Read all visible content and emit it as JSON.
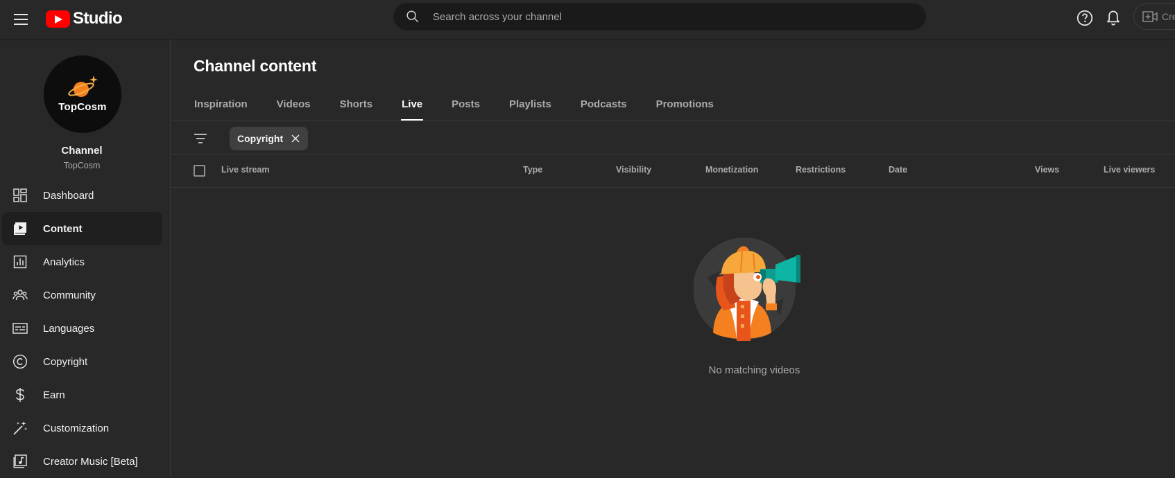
{
  "app": {
    "brand_text": "Studio",
    "search_placeholder": "Search across your channel",
    "create_label": "Cre"
  },
  "sidebar": {
    "avatar_text": "TopCosm",
    "channel_title": "Channel",
    "channel_name": "TopCosm",
    "items": [
      {
        "label": "Dashboard",
        "icon": "dashboard-icon"
      },
      {
        "label": "Content",
        "icon": "content-icon",
        "active": true
      },
      {
        "label": "Analytics",
        "icon": "analytics-icon"
      },
      {
        "label": "Community",
        "icon": "community-icon"
      },
      {
        "label": "Languages",
        "icon": "languages-icon"
      },
      {
        "label": "Copyright",
        "icon": "copyright-icon"
      },
      {
        "label": "Earn",
        "icon": "dollar-icon"
      },
      {
        "label": "Customization",
        "icon": "magic-wand-icon"
      },
      {
        "label": "Creator Music [Beta]",
        "icon": "music-note-icon"
      }
    ]
  },
  "main": {
    "title": "Channel content",
    "tabs": [
      {
        "label": "Inspiration"
      },
      {
        "label": "Videos"
      },
      {
        "label": "Shorts"
      },
      {
        "label": "Live",
        "active": true
      },
      {
        "label": "Posts"
      },
      {
        "label": "Playlists"
      },
      {
        "label": "Podcasts"
      },
      {
        "label": "Promotions"
      }
    ],
    "filter_chip": "Copyright",
    "columns": [
      "Live stream",
      "Type",
      "Visibility",
      "Monetization",
      "Restrictions",
      "Date",
      "Views",
      "Live viewers"
    ],
    "empty_message": "No matching videos"
  },
  "colors": {
    "background": "#282828",
    "brand_red": "#ff0000",
    "accent_orange": "#f4801f",
    "teal": "#0d9e8f"
  }
}
